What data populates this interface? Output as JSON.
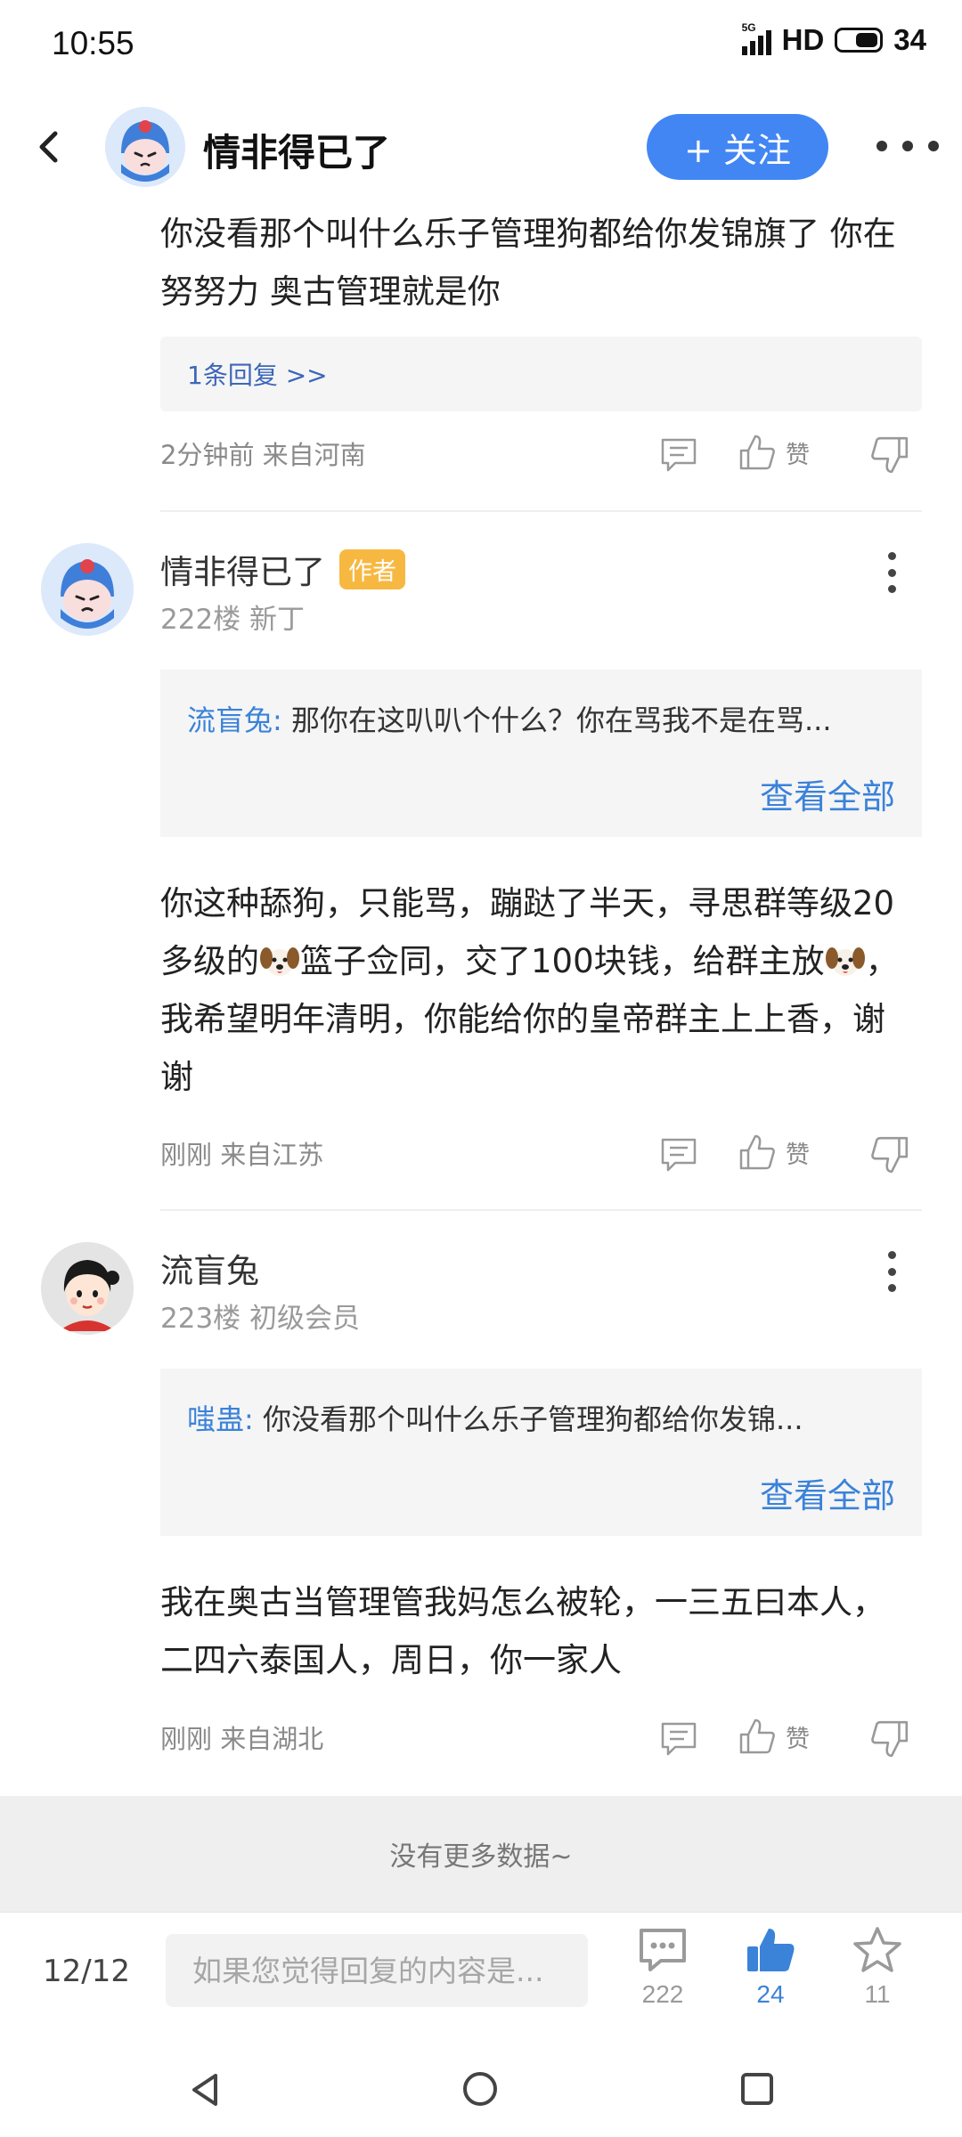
{
  "status_bar": {
    "time": "10:55",
    "network": "5G",
    "hd": "HD",
    "battery": "34"
  },
  "header": {
    "title": "情非得已了",
    "follow_label": "+ 关注"
  },
  "comments": [
    {
      "text": "你没看那个叫什么乐子管理狗都给你发锦旗了  你在努努力  奥古管理就是你",
      "reply_count_label": "1条回复 >>",
      "meta": "2分钟前 来自河南",
      "like_label": "赞"
    },
    {
      "user": "情非得已了",
      "badge": "作者",
      "floor": "222楼 新丁",
      "quote_author": "流盲兔:",
      "quote_text": "那你在这叭叭个什么？你在骂我不是在骂...",
      "see_all": "查看全部",
      "text_part1": "你这种舔狗，只能骂，蹦跶了半天，寻思群等级20多级的",
      "text_part2": "篮子佥同，交了100块钱，给群主放",
      "text_part3": "，我希望明年清明，你能给你的皇帝群主上上香，谢谢",
      "meta": "刚刚 来自江苏",
      "like_label": "赞"
    },
    {
      "user": "流盲兔",
      "floor": "223楼 初级会员",
      "quote_author": "嗤蛊:",
      "quote_text": "你没看那个叫什么乐子管理狗都给你发锦...",
      "see_all": "查看全部",
      "text": "我在奥古当管理管我妈怎么被轮，一三五曰本人，二四六泰国人，周日，你一家人",
      "meta": "刚刚 来自湖北",
      "like_label": "赞"
    }
  ],
  "no_more": "没有更多数据~",
  "bottom_bar": {
    "page": "12/12",
    "input_placeholder": "如果您觉得回复的内容是...",
    "comments_count": "222",
    "likes_count": "24",
    "favorites_count": "11"
  },
  "colors": {
    "accent": "#4286f4",
    "link": "#3b82d9",
    "badge": "#f7b842"
  }
}
